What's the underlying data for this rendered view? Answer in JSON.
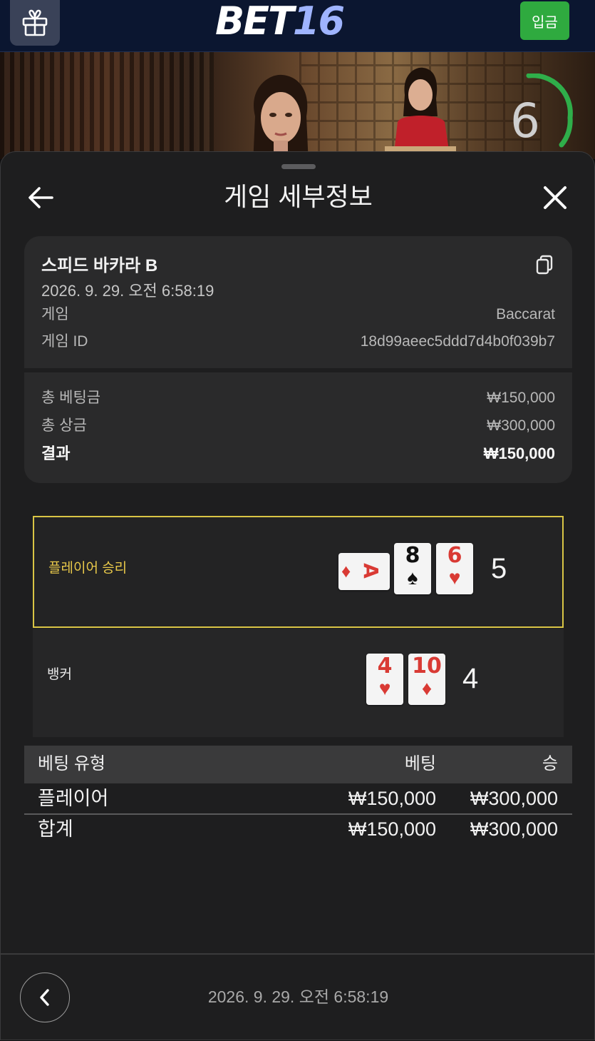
{
  "header": {
    "logo_main": "BET",
    "logo_num": "16",
    "deposit_label": "입금"
  },
  "video": {
    "countdown": "6"
  },
  "sheet": {
    "title": "게임 세부정보",
    "game_name": "스피드 바카라 B",
    "date": "2026. 9. 29. 오전 6:58:19",
    "game_label": "게임",
    "game_value": "Baccarat",
    "game_id_label": "게임 ID",
    "game_id_value": "18d99aeec5ddd7d4b0f039b7",
    "total_bet_label": "총 베팅금",
    "total_bet_value": "₩150,000",
    "total_prize_label": "총 상금",
    "total_prize_value": "₩300,000",
    "result_label": "결과",
    "result_value": "₩150,000"
  },
  "hands": {
    "player": {
      "label": "플레이어 승리",
      "total": "5",
      "cards": [
        {
          "rank": "A",
          "suit": "♦",
          "rotated": true
        },
        {
          "rank": "8",
          "suit": "♠"
        },
        {
          "rank": "6",
          "suit": "♥"
        }
      ]
    },
    "banker": {
      "label": "뱅커",
      "total": "4",
      "cards": [
        {
          "rank": "4",
          "suit": "♥"
        },
        {
          "rank": "10",
          "suit": "♦"
        }
      ]
    }
  },
  "bets_table": {
    "headers": [
      "베팅 유형",
      "베팅",
      "승"
    ],
    "rows": [
      {
        "type": "플레이어",
        "bet": "₩150,000",
        "win": "₩300,000"
      },
      {
        "type": "합계",
        "bet": "₩150,000",
        "win": "₩300,000"
      }
    ]
  },
  "footer": {
    "date": "2026. 9. 29. 오전 6:58:19"
  },
  "colors": {
    "accent_gold": "#d9c545",
    "deposit_green": "#2faa3f",
    "timer_green": "#2fae4a",
    "card_red": "#d93a34"
  }
}
